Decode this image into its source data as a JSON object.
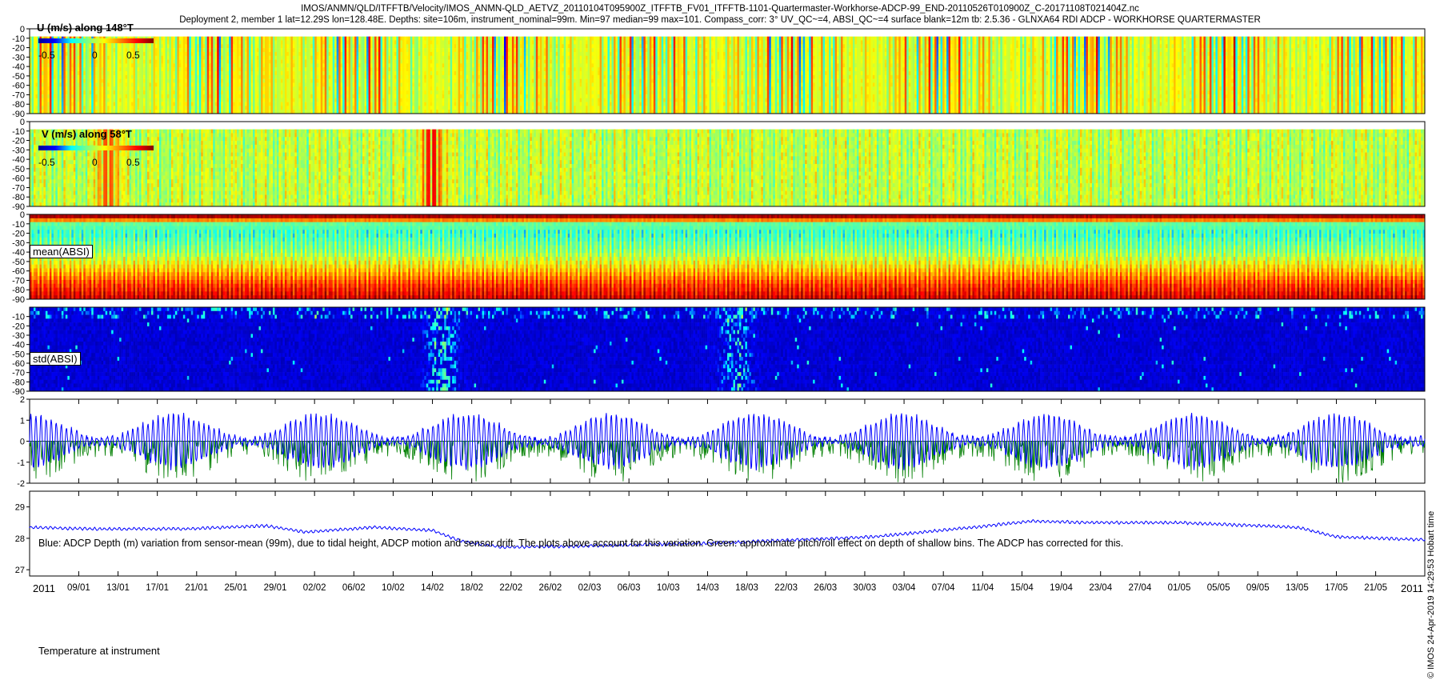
{
  "header": {
    "title_line1": "IMOS/ANMN/QLD/ITFFTB/Velocity/IMOS_ANMN-QLD_AETVZ_20110104T095900Z_ITFFTB_FV01_ITFFTB-1101-Quartermaster-Workhorse-ADCP-99_END-20110526T010900Z_C-20171108T021404Z.nc",
    "title_line2": "Deployment 2, member 1 lat=12.29S lon=128.48E. Depths: site=106m, instrument_nominal=99m. Min=97 median=99 max=101. Compass_corr: 3° UV_QC~=4, ABSI_QC~=4 surface blank=12m tb: 2.5.36 - GLNXA64 RDI ADCP - WORKHORSE QUARTERMASTER"
  },
  "side_label": "© IMOS 24-Apr-2019 14:29:53 Hobart time",
  "colors": {
    "jet": [
      "#00008f",
      "#0000ff",
      "#00ffff",
      "#7fff7f",
      "#ffff00",
      "#ff8000",
      "#ff0000",
      "#800000"
    ],
    "depth_line": "#0000ff",
    "pitch_roll_line": "#007f00",
    "temperature_line": "#0000ff"
  },
  "chart_data": [
    {
      "type": "heatmap",
      "label": "U (m/s) along 148°T",
      "colorbar_ticks": [
        "-0.5",
        "0",
        "0.5"
      ],
      "clim": [
        -0.8,
        0.8
      ],
      "ylim": [
        -90,
        0
      ],
      "yticks": [
        0,
        -10,
        -20,
        -30,
        -40,
        -50,
        -60,
        -70,
        -80,
        -90
      ],
      "blank_depth": -10,
      "mean_value": 0.05,
      "variability": 0.55,
      "vertical_structure": "tidally banded, stronger near surface"
    },
    {
      "type": "heatmap",
      "label": "V (m/s) along 58°T",
      "colorbar_ticks": [
        "-0.5",
        "0",
        "0.5"
      ],
      "clim": [
        -0.8,
        0.8
      ],
      "ylim": [
        -90,
        0
      ],
      "yticks": [
        0,
        -10,
        -20,
        -30,
        -40,
        -50,
        -60,
        -70,
        -80,
        -90
      ],
      "blank_depth": -10,
      "mean_value": 0.0,
      "variability": 0.3,
      "events": [
        {
          "date": "2011-02-14",
          "value": 0.6
        },
        {
          "date": "2011-01-12",
          "value": 0.45
        }
      ]
    },
    {
      "type": "heatmap",
      "label": "mean(ABSI)",
      "ylim": [
        -90,
        0
      ],
      "yticks": [
        0,
        -10,
        -20,
        -30,
        -40,
        -50,
        -60,
        -70,
        -80,
        -90
      ],
      "profile_by_depth": [
        [
          -3,
          0.95
        ],
        [
          -10,
          0.4
        ],
        [
          -20,
          0.35
        ],
        [
          -40,
          0.45
        ],
        [
          -60,
          0.65
        ],
        [
          -75,
          0.8
        ],
        [
          -88,
          0.9
        ]
      ]
    },
    {
      "type": "heatmap",
      "label": "std(ABSI)",
      "ylim": [
        -90,
        0
      ],
      "yticks": [
        -10,
        -20,
        -30,
        -40,
        -50,
        -60,
        -70,
        -80,
        -90
      ],
      "background_level": 0.05,
      "events": [
        {
          "date": "2011-02-15",
          "level": 0.4
        },
        {
          "date": "2011-03-17",
          "level": 0.35
        }
      ]
    },
    {
      "type": "line",
      "ylim": [
        -2,
        2
      ],
      "yticks": [
        "2",
        "1",
        "0",
        "-1",
        "-2"
      ],
      "annotation": "Blue: ADCP Depth (m) variation from sensor-mean (99m), due to tidal height, ADCP motion and sensor drift. The plots above account for this variation. Green: approximate pitch/roll effect on depth of shallow bins. The ADCP has corrected for this.",
      "series": [
        {
          "color": "blue",
          "tidal_amplitude_m": 1.7,
          "spring_neap_days": 14.8
        },
        {
          "color": "green",
          "baseline_m": 0,
          "max_drop_m": -2.0
        }
      ]
    },
    {
      "type": "line",
      "label": "Temperature at instrument",
      "ylim": [
        26.8,
        29.5
      ],
      "yticks": [
        "29",
        "28",
        "27"
      ],
      "series": [
        {
          "x": [
            "2011-01-04",
            "2011-01-10",
            "2011-01-20",
            "2011-01-28",
            "2011-02-01",
            "2011-02-08",
            "2011-02-14",
            "2011-02-17",
            "2011-02-21",
            "2011-03-01",
            "2011-03-15",
            "2011-03-31",
            "2011-04-10",
            "2011-04-16",
            "2011-04-22",
            "2011-05-01",
            "2011-05-13",
            "2011-05-17",
            "2011-05-26"
          ],
          "y": [
            28.35,
            28.3,
            28.3,
            28.4,
            28.2,
            28.35,
            28.25,
            27.9,
            27.72,
            27.75,
            27.85,
            28.05,
            28.35,
            28.55,
            28.5,
            28.5,
            28.35,
            28.05,
            27.95
          ]
        }
      ]
    }
  ],
  "x_axis": {
    "start_date": "2011-01-04",
    "end_date": "2011-05-26",
    "year_labels": [
      {
        "date": "2011-01-04",
        "text": "2011"
      },
      {
        "date": "2011-05-26",
        "text": "2011"
      }
    ],
    "ticks": [
      {
        "date": "2011-01-09",
        "text": "09/01"
      },
      {
        "date": "2011-01-13",
        "text": "13/01"
      },
      {
        "date": "2011-01-17",
        "text": "17/01"
      },
      {
        "date": "2011-01-21",
        "text": "21/01"
      },
      {
        "date": "2011-01-25",
        "text": "25/01"
      },
      {
        "date": "2011-01-29",
        "text": "29/01"
      },
      {
        "date": "2011-02-02",
        "text": "02/02"
      },
      {
        "date": "2011-02-06",
        "text": "06/02"
      },
      {
        "date": "2011-02-10",
        "text": "10/02"
      },
      {
        "date": "2011-02-14",
        "text": "14/02"
      },
      {
        "date": "2011-02-18",
        "text": "18/02"
      },
      {
        "date": "2011-02-22",
        "text": "22/02"
      },
      {
        "date": "2011-02-26",
        "text": "26/02"
      },
      {
        "date": "2011-03-02",
        "text": "02/03"
      },
      {
        "date": "2011-03-06",
        "text": "06/03"
      },
      {
        "date": "2011-03-10",
        "text": "10/03"
      },
      {
        "date": "2011-03-14",
        "text": "14/03"
      },
      {
        "date": "2011-03-18",
        "text": "18/03"
      },
      {
        "date": "2011-03-22",
        "text": "22/03"
      },
      {
        "date": "2011-03-26",
        "text": "26/03"
      },
      {
        "date": "2011-03-30",
        "text": "30/03"
      },
      {
        "date": "2011-04-03",
        "text": "03/04"
      },
      {
        "date": "2011-04-07",
        "text": "07/04"
      },
      {
        "date": "2011-04-11",
        "text": "11/04"
      },
      {
        "date": "2011-04-15",
        "text": "15/04"
      },
      {
        "date": "2011-04-19",
        "text": "19/04"
      },
      {
        "date": "2011-04-23",
        "text": "23/04"
      },
      {
        "date": "2011-04-27",
        "text": "27/04"
      },
      {
        "date": "2011-05-01",
        "text": "01/05"
      },
      {
        "date": "2011-05-05",
        "text": "05/05"
      },
      {
        "date": "2011-05-09",
        "text": "09/05"
      },
      {
        "date": "2011-05-13",
        "text": "13/05"
      },
      {
        "date": "2011-05-17",
        "text": "17/05"
      },
      {
        "date": "2011-05-21",
        "text": "21/05"
      }
    ]
  }
}
